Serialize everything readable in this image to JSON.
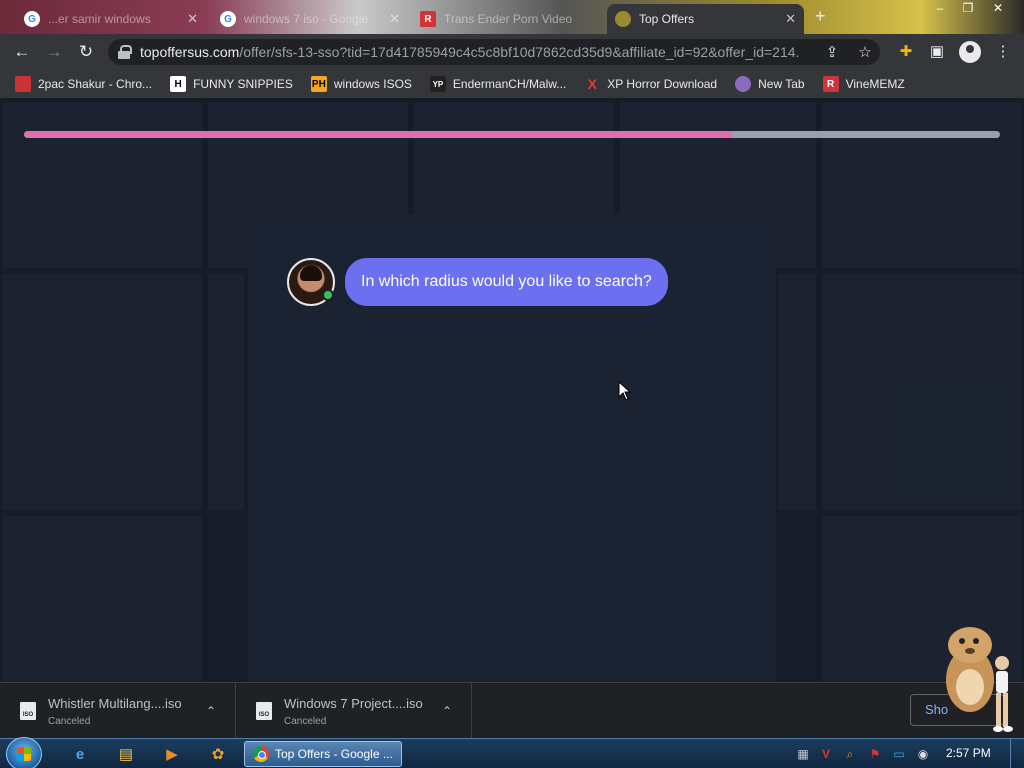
{
  "browser": {
    "tabs": [
      {
        "title": "...er samir windows",
        "favicon": "google-icon",
        "active": false
      },
      {
        "title": "windows 7 iso - Google",
        "favicon": "google-icon",
        "active": false
      },
      {
        "title": "Trans Ender Porn Video",
        "favicon": "r-icon",
        "active": false
      },
      {
        "title": "Top Offers",
        "favicon": "page-icon",
        "active": true
      }
    ],
    "new_tab": "+",
    "address": {
      "host": "topoffersus.com",
      "path": "/offer/sfs-13-sso?tid=17d41785949c4c5c8bf10d7862cd35d9&affiliate_id=92&offer_id=214..."
    },
    "bookmarks": [
      {
        "label": "2pac Shakur - Chro...",
        "icon": "bookmark-favicon"
      },
      {
        "label": "FUNNY SNIPPIES",
        "icon": "H"
      },
      {
        "label": "windows ISOS",
        "icon": "PH"
      },
      {
        "label": "EndermanCH/Malw...",
        "icon": "YP"
      },
      {
        "label": "XP Horror Download",
        "icon": "X"
      },
      {
        "label": "New Tab",
        "icon": "globe-icon"
      },
      {
        "label": "VineMEMZ",
        "icon": "R"
      }
    ]
  },
  "page": {
    "progress_fraction": 0.725,
    "chat_message": "In which radius would you like to search?",
    "colors": {
      "bubble": "#6b6ff0",
      "progress": "#e06fb0",
      "online": "#3fbf4b"
    }
  },
  "downloads": [
    {
      "name": "Whistler Multilang....iso",
      "status": "Canceled"
    },
    {
      "name": "Windows 7 Project....iso",
      "status": "Canceled"
    }
  ],
  "show_all_label": "Sho",
  "taskbar": {
    "task_label": "Top Offers - Google ...",
    "clock": "2:57 PM"
  }
}
